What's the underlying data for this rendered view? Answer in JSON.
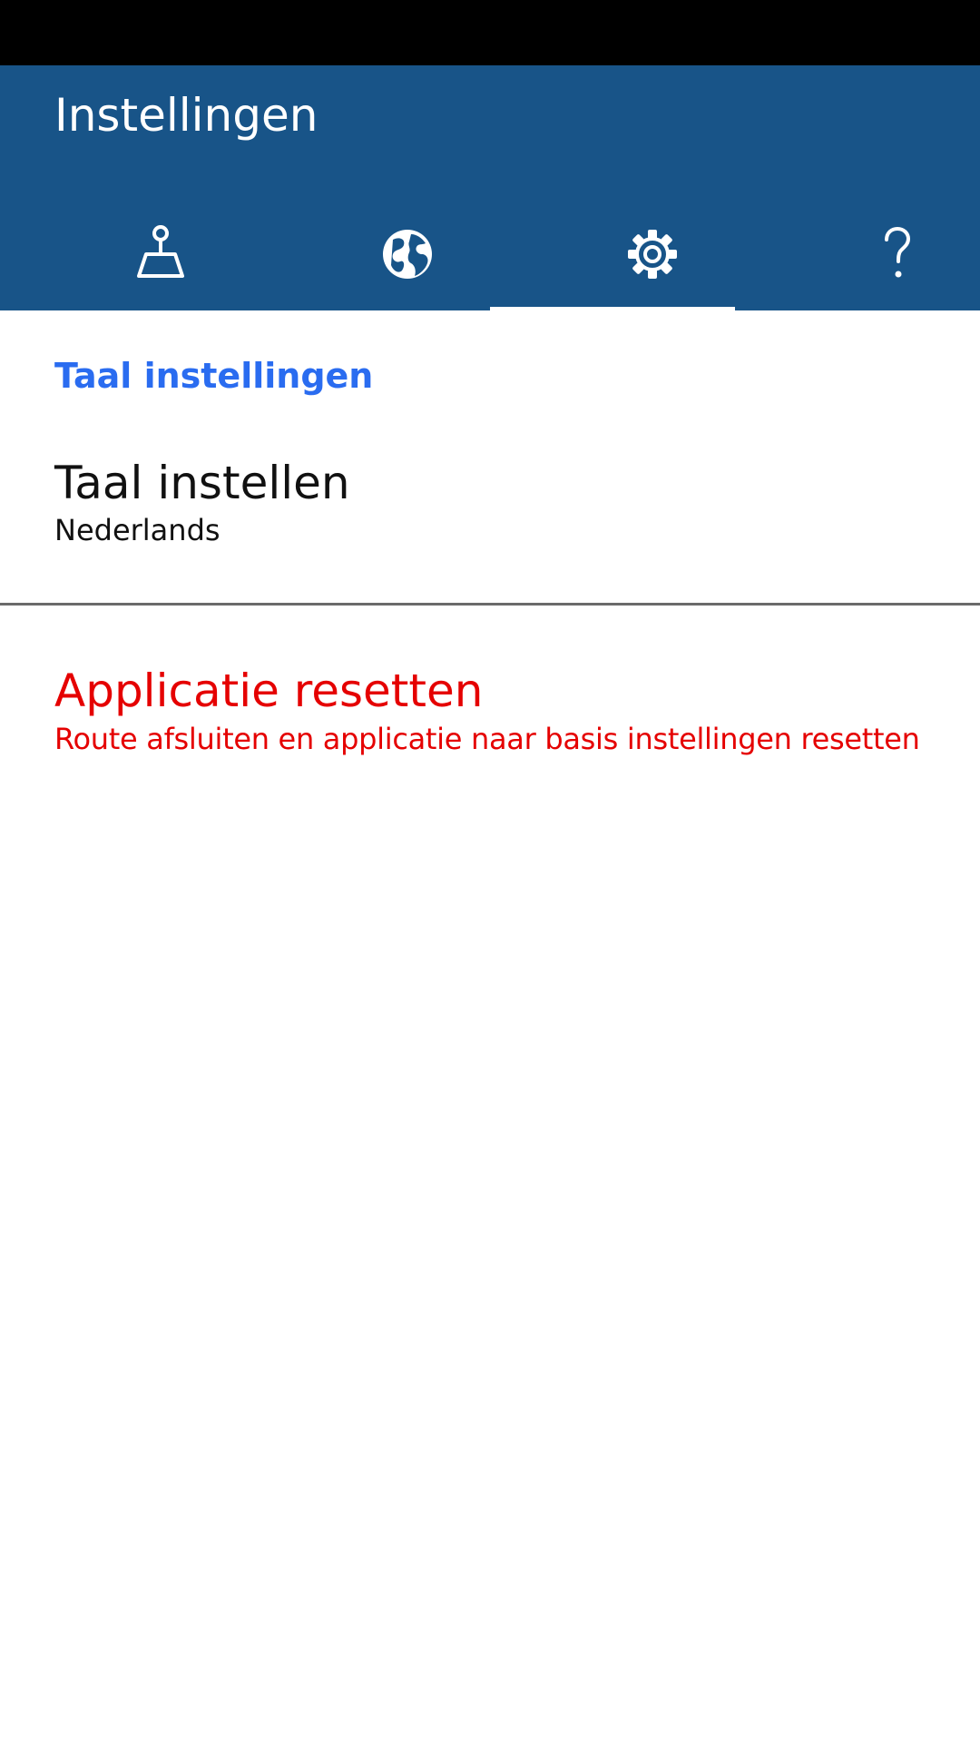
{
  "header": {
    "title": "Instellingen",
    "background_color": "#185488"
  },
  "tabs": [
    {
      "icon": "map-marker-icon",
      "active": false
    },
    {
      "icon": "globe-icon",
      "active": false
    },
    {
      "icon": "gear-icon",
      "active": true
    },
    {
      "icon": "help-icon",
      "active": false
    }
  ],
  "language_section": {
    "heading": "Taal instellingen",
    "setting_title": "Taal instellen",
    "setting_value": "Nederlands",
    "accent_color": "#2a6cf0"
  },
  "reset_section": {
    "title": "Applicatie resetten",
    "description": "Route afsluiten en applicatie naar basis instellingen resetten",
    "color": "#e50000"
  }
}
